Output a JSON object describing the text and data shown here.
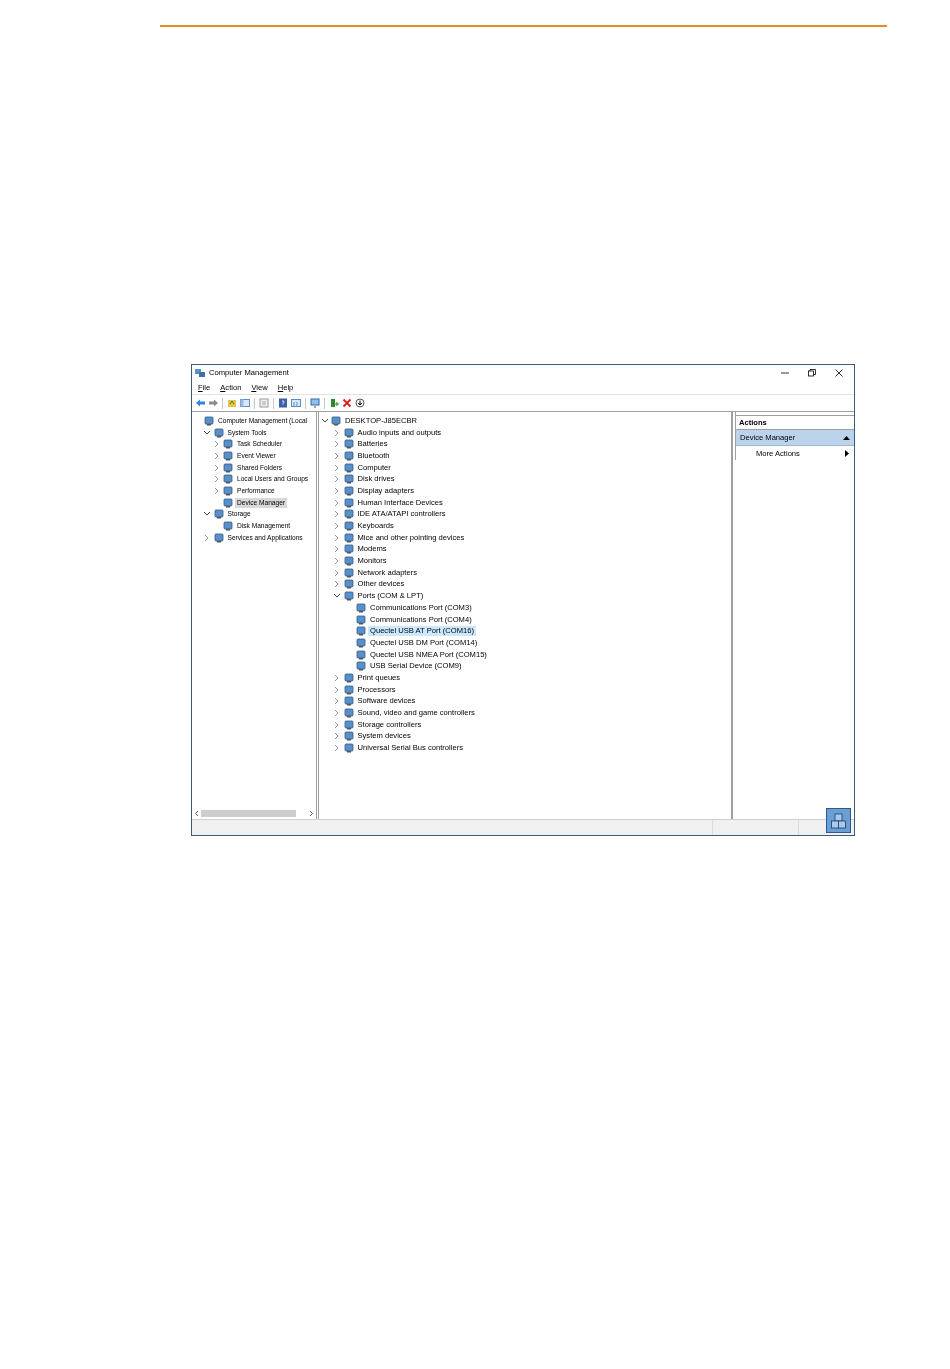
{
  "window": {
    "title": "Computer Management"
  },
  "menu": [
    {
      "label": "File"
    },
    {
      "label": "Action"
    },
    {
      "label": "View"
    },
    {
      "label": "Help"
    }
  ],
  "left_tree": [
    {
      "label": "Computer Management (Local",
      "selected": false,
      "children": [
        {
          "label": "System Tools",
          "expanded": true,
          "selected": false,
          "children": [
            {
              "label": "Task Scheduler",
              "expanded": false,
              "selected": false
            },
            {
              "label": "Event Viewer",
              "expanded": false,
              "selected": false
            },
            {
              "label": "Shared Folders",
              "expanded": false,
              "selected": false
            },
            {
              "label": "Local Users and Groups",
              "expanded": false,
              "selected": false
            },
            {
              "label": "Performance",
              "expanded": false,
              "selected": false
            },
            {
              "label": "Device Manager",
              "selected": true
            }
          ]
        },
        {
          "label": "Storage",
          "expanded": true,
          "selected": false,
          "children": [
            {
              "label": "Disk Management",
              "selected": false
            }
          ]
        },
        {
          "label": "Services and Applications",
          "expanded": false,
          "selected": false
        }
      ]
    }
  ],
  "device_tree": [
    {
      "label": "DESKTOP-J85ECBR",
      "expanded": true,
      "selected": false,
      "children": [
        {
          "label": "Audio inputs and outputs",
          "expanded": false,
          "selected": false
        },
        {
          "label": "Batteries",
          "expanded": false,
          "selected": false
        },
        {
          "label": "Bluetooth",
          "expanded": false,
          "selected": false
        },
        {
          "label": "Computer",
          "expanded": false,
          "selected": false
        },
        {
          "label": "Disk drives",
          "expanded": false,
          "selected": false
        },
        {
          "label": "Display adapters",
          "expanded": false,
          "selected": false
        },
        {
          "label": "Human Interface Devices",
          "expanded": false,
          "selected": false
        },
        {
          "label": "IDE ATA/ATAPI controllers",
          "expanded": false,
          "selected": false
        },
        {
          "label": "Keyboards",
          "expanded": false,
          "selected": false
        },
        {
          "label": "Mice and other pointing devices",
          "expanded": false,
          "selected": false
        },
        {
          "label": "Modems",
          "expanded": false,
          "selected": false
        },
        {
          "label": "Monitors",
          "expanded": false,
          "selected": false
        },
        {
          "label": "Network adapters",
          "expanded": false,
          "selected": false
        },
        {
          "label": "Other devices",
          "expanded": false,
          "selected": false
        },
        {
          "label": "Ports (COM & LPT)",
          "expanded": true,
          "selected": false,
          "children": [
            {
              "label": "Communications Port (COM3)",
              "selected": false
            },
            {
              "label": "Communications Port (COM4)",
              "selected": false
            },
            {
              "label": "Quectel USB AT Port (COM16)",
              "selected": true
            },
            {
              "label": "Quectel USB DM Port (COM14)",
              "selected": false
            },
            {
              "label": "Quectel USB NMEA Port (COM15)",
              "selected": false
            },
            {
              "label": "USB Serial Device (COM9)",
              "selected": false
            }
          ]
        },
        {
          "label": "Print queues",
          "expanded": false,
          "selected": false
        },
        {
          "label": "Processors",
          "expanded": false,
          "selected": false
        },
        {
          "label": "Software devices",
          "expanded": false,
          "selected": false
        },
        {
          "label": "Sound, video and game controllers",
          "expanded": false,
          "selected": false
        },
        {
          "label": "Storage controllers",
          "expanded": false,
          "selected": false
        },
        {
          "label": "System devices",
          "expanded": false,
          "selected": false
        },
        {
          "label": "Universal Serial Bus controllers",
          "expanded": false,
          "selected": false
        }
      ]
    }
  ],
  "actions": {
    "title": "Actions",
    "section": {
      "label": "Device Manager",
      "expanded": true
    },
    "items": [
      "More Actions"
    ]
  }
}
